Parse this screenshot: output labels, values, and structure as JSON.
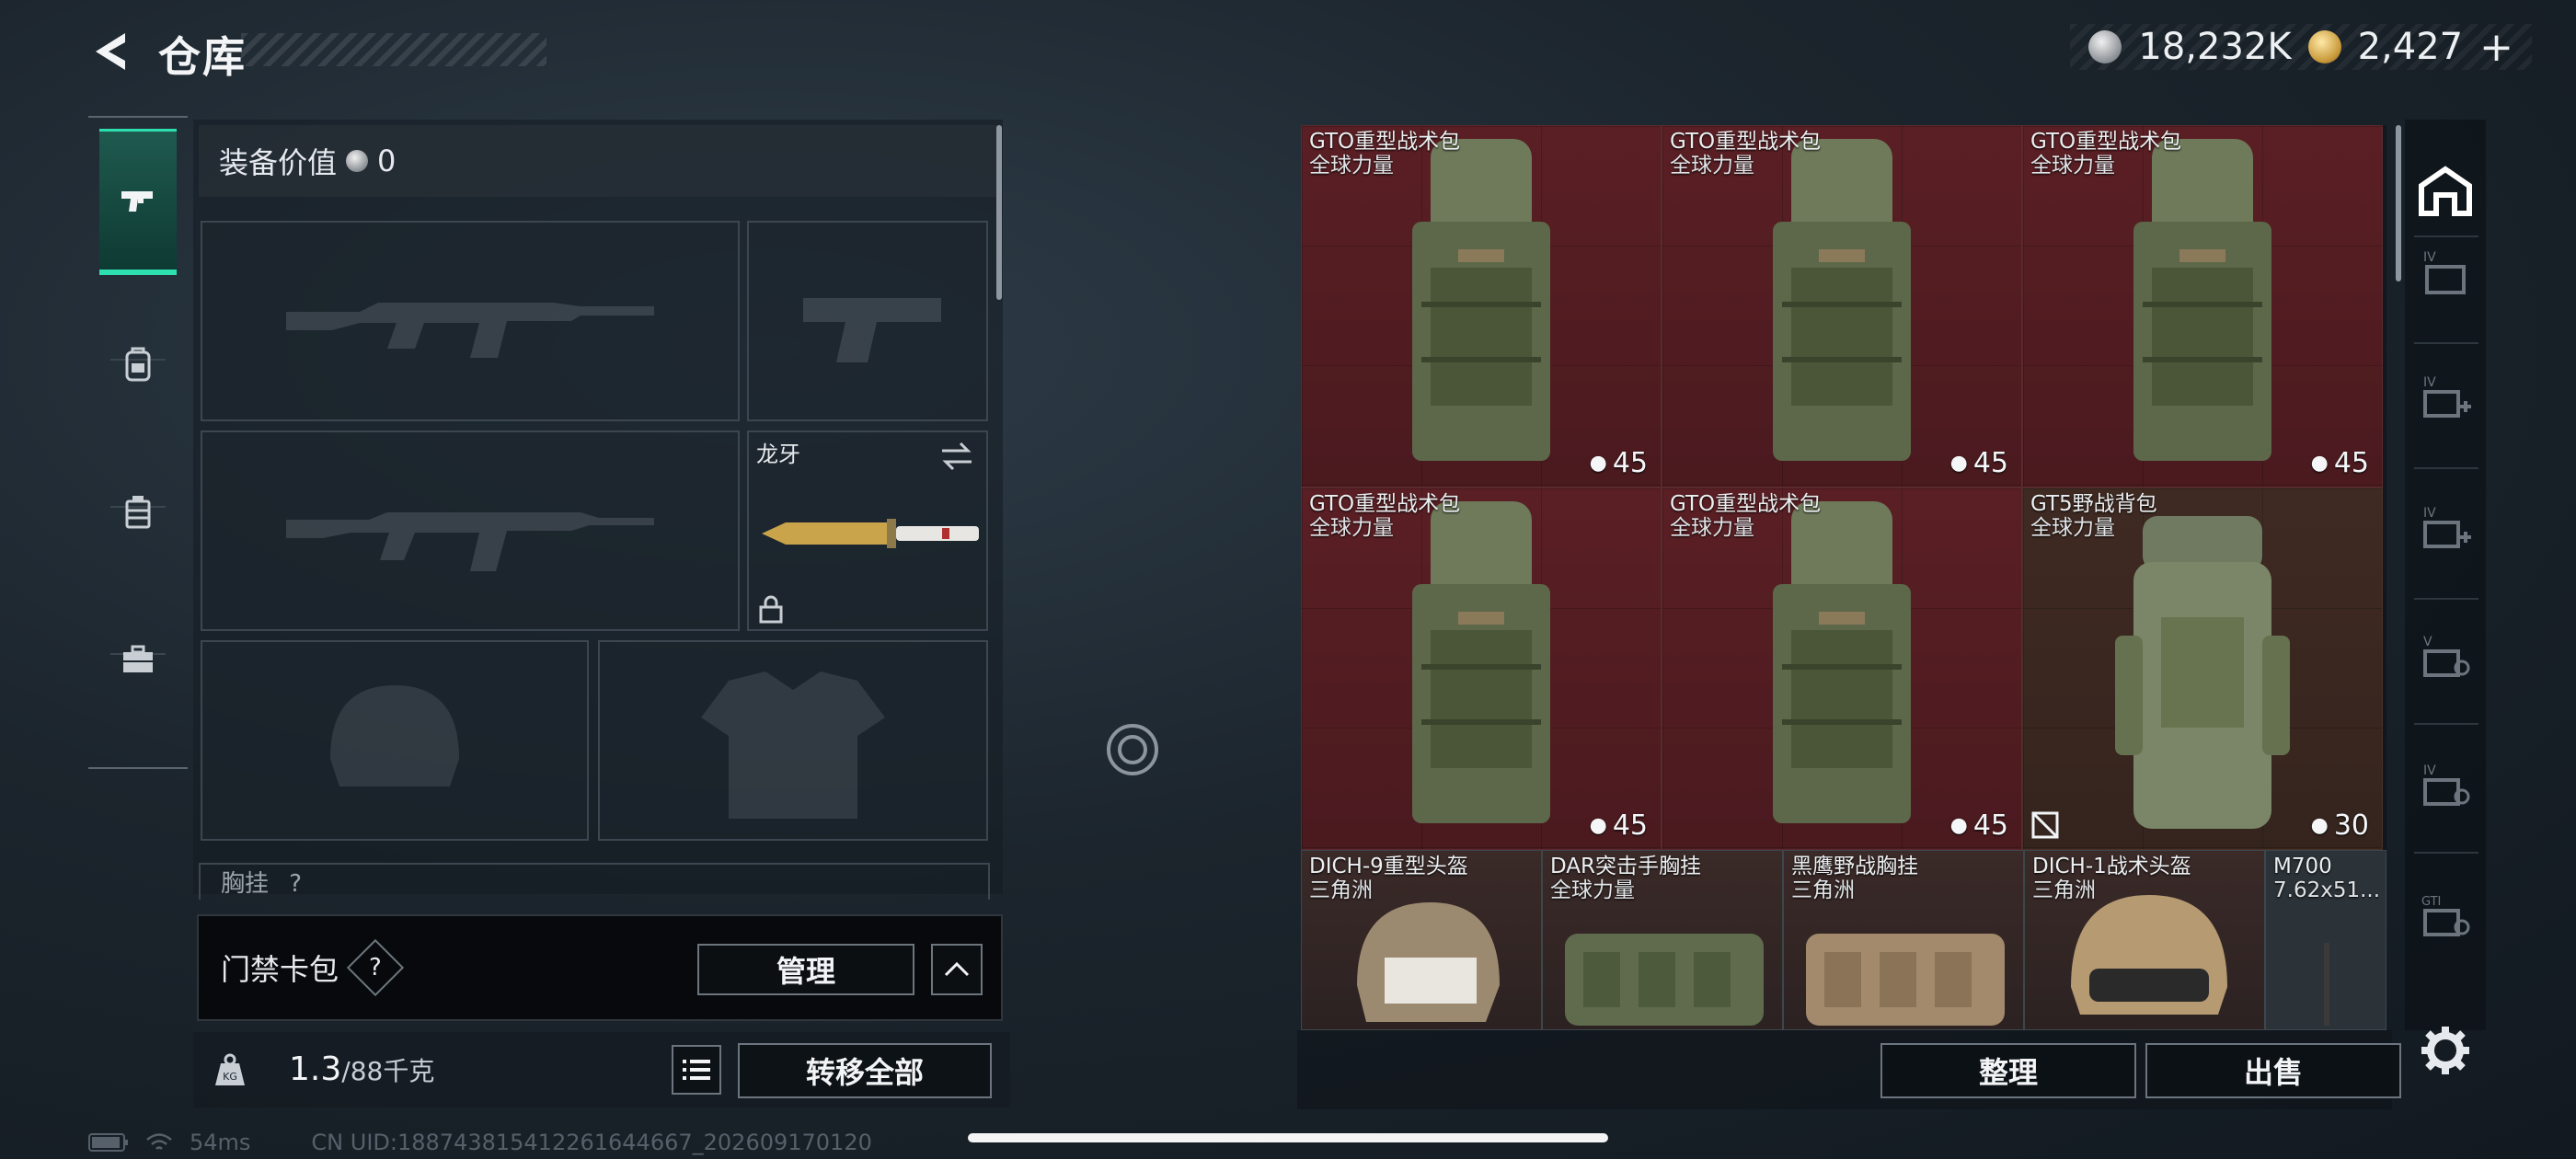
{
  "header": {
    "title": "仓库",
    "currency_silver": "18,232K",
    "currency_gold": "2,427",
    "add_label": "+"
  },
  "sidebar_left": {
    "tabs": [
      {
        "name": "weapons",
        "icon": "pistol-icon",
        "active": true
      },
      {
        "name": "backpack",
        "icon": "backpack-icon",
        "active": false
      },
      {
        "name": "chest-rig",
        "icon": "chest-rig-icon",
        "active": false
      },
      {
        "name": "toolbox",
        "icon": "briefcase-icon",
        "active": false
      }
    ]
  },
  "equipment": {
    "value_label": "装备价值",
    "value": "0",
    "melee_name": "龙牙",
    "chest_rig_label": "胸挂",
    "chest_rig_count": "?"
  },
  "access_card": {
    "label": "门禁卡包",
    "help": "?",
    "manage_button": "管理"
  },
  "weight": {
    "current": "1.3",
    "max_label": "/88千克",
    "transfer_all_button": "转移全部"
  },
  "storage": {
    "items": [
      {
        "name": "GTO重型战术包",
        "source": "全球力量",
        "capacity": "45"
      },
      {
        "name": "GTO重型战术包",
        "source": "全球力量",
        "capacity": "45"
      },
      {
        "name": "GTO重型战术包",
        "source": "全球力量",
        "capacity": "45"
      },
      {
        "name": "GTO重型战术包",
        "source": "全球力量",
        "capacity": "45"
      },
      {
        "name": "GTO重型战术包",
        "source": "全球力量",
        "capacity": "45"
      },
      {
        "name": "GT5野战背包",
        "source": "全球力量",
        "capacity": "30"
      },
      {
        "name": "DICH-9重型头盔",
        "source": "三角洲"
      },
      {
        "name": "DAR突击手胸挂",
        "source": "全球力量"
      },
      {
        "name": "黑鹰野战胸挂",
        "source": "三角洲"
      },
      {
        "name": "DICH-1战术头盔",
        "source": "三角洲"
      },
      {
        "name": "M700",
        "source": "7.62x51..."
      }
    ],
    "sort_button": "整理",
    "sell_button": "出售"
  },
  "status_bar": {
    "ping": "54ms",
    "uid": "CN UID:18874381541226164466​7_202609170120"
  },
  "colors": {
    "accent": "#2ee0b0",
    "cell_red": "#4e1c21",
    "cell_brown": "#3a2720"
  }
}
